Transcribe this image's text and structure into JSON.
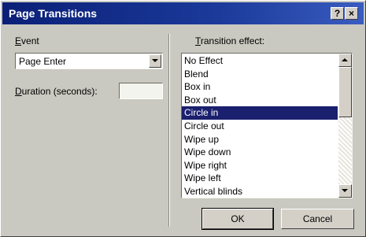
{
  "window": {
    "title": "Page Transitions",
    "help_glyph": "?",
    "close_glyph": "×"
  },
  "event": {
    "label_underlined": "E",
    "label_rest": "vent",
    "selected_value": "Page Enter"
  },
  "duration": {
    "label_underlined": "D",
    "label_rest": "uration (seconds):",
    "value": ""
  },
  "transition": {
    "label_underlined": "T",
    "label_rest": "ransition effect:",
    "items": [
      "No Effect",
      "Blend",
      "Box in",
      "Box out",
      "Circle in",
      "Circle out",
      "Wipe up",
      "Wipe down",
      "Wipe right",
      "Wipe left",
      "Vertical blinds"
    ],
    "selected_index": 4
  },
  "buttons": {
    "ok_label": "OK",
    "cancel_label": "Cancel"
  },
  "colors": {
    "title_bar": "#0a1f77",
    "selection": "#1a1f6e",
    "dialog_face": "#c9c9c1"
  }
}
